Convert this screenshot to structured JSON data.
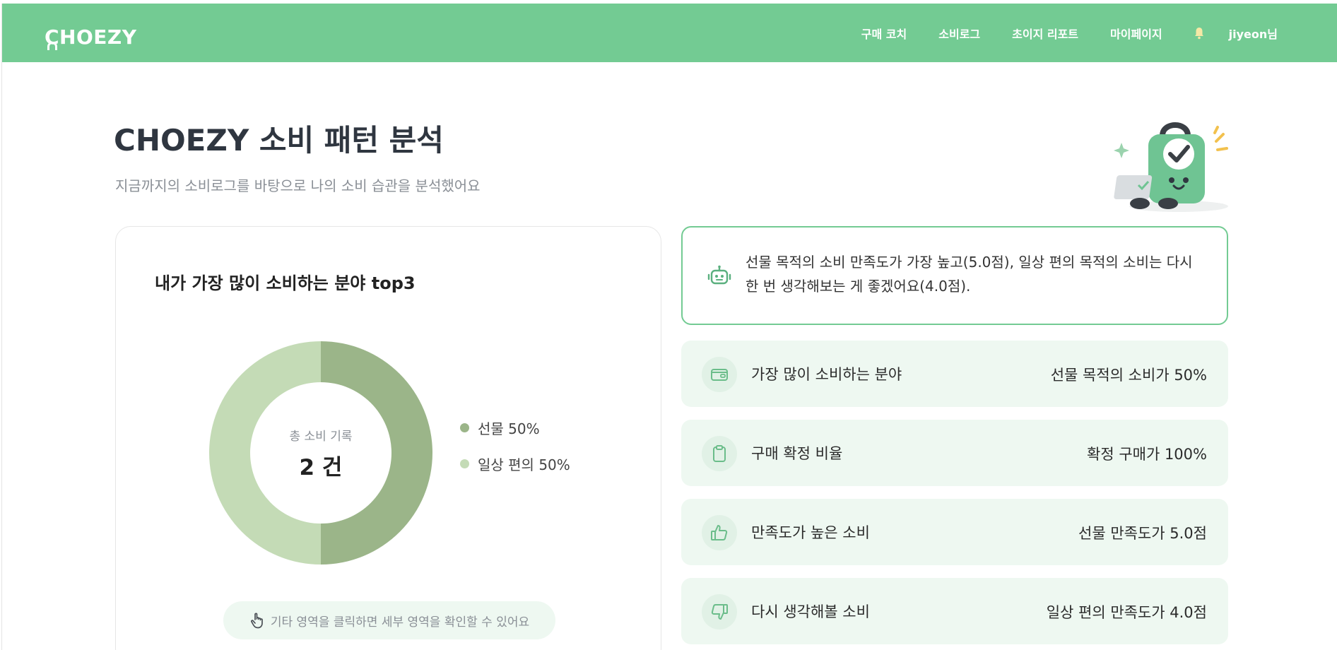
{
  "header": {
    "logo": "CHOEZY",
    "nav": [
      "구매 코치",
      "소비로그",
      "초이지 리포트",
      "마이페이지"
    ],
    "user": "jiyeon님"
  },
  "page": {
    "title": "CHOEZY 소비 패턴 분석",
    "subtitle": "지금까지의 소비로그를 바탕으로 나의 소비 습관을 분석했어요"
  },
  "top_card": {
    "title": "내가 가장 많이 소비하는 분야 top3",
    "center_label": "총 소비 기록",
    "center_value": "2 건",
    "hint": "기타 영역을 클릭하면 세부 영역을 확인할 수 있어요"
  },
  "chart_data": {
    "type": "pie",
    "categories": [
      "선물",
      "일상 편의"
    ],
    "values": [
      50,
      50
    ],
    "legend_labels": [
      "선물 50%",
      "일상 편의 50%"
    ],
    "colors": [
      "#9bb589",
      "#c4dbb6"
    ],
    "legend": "right"
  },
  "insight": {
    "text": "선물 목적의 소비 만족도가 가장 높고(5.0점), 일상 편의 목적의 소비는 다시 한 번 생각해보는 게 좋겠어요(4.0점)."
  },
  "stats": [
    {
      "icon": "wallet-icon",
      "label": "가장 많이 소비하는 분야",
      "value": "선물 목적의 소비가 50%"
    },
    {
      "icon": "clipboard-icon",
      "label": "구매 확정 비율",
      "value": "확정 구매가 100%"
    },
    {
      "icon": "thumbs-up-icon",
      "label": "만족도가 높은 소비",
      "value": "선물 만족도가 5.0점"
    },
    {
      "icon": "thumbs-down-icon",
      "label": "다시 생각해볼 소비",
      "value": "일상 편의 만족도가 4.0점"
    }
  ],
  "colors": {
    "brand": "#73cb93",
    "accent_bg": "#eef8f1",
    "icon": "#6bbd8a"
  }
}
